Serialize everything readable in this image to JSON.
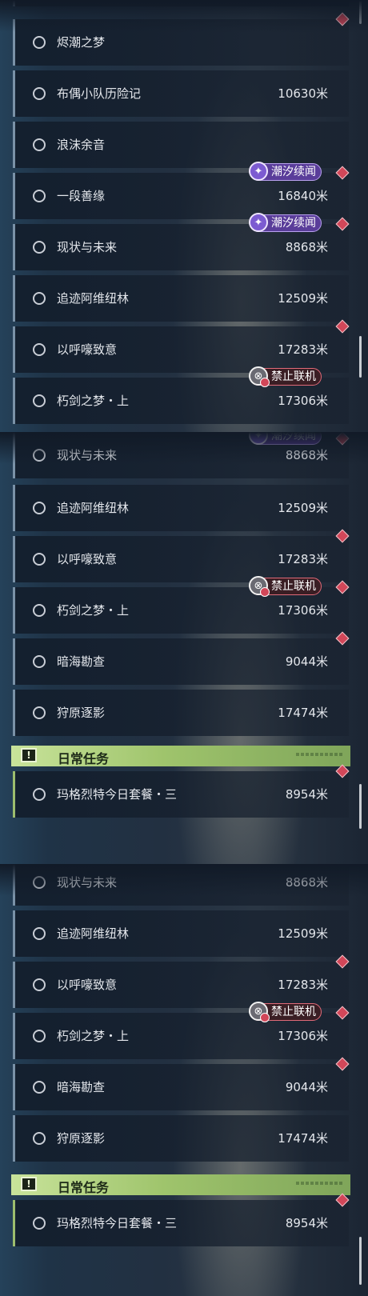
{
  "quests_panel1": [
    {
      "name": "烬潮之梦",
      "distance": ""
    },
    {
      "name": "布偶小队历险记",
      "distance": "10630米"
    },
    {
      "name": "浪沫余音",
      "distance": ""
    },
    {
      "name": "一段善缘",
      "distance": "16840米"
    },
    {
      "name": "现状与未来",
      "distance": "8868米"
    },
    {
      "name": "追迹阿维纽林",
      "distance": "12509米"
    },
    {
      "name": "以呼嚎致意",
      "distance": "17283米"
    },
    {
      "name": "朽剑之梦・上",
      "distance": "17306米"
    }
  ],
  "quests_panel2": [
    {
      "name": "现状与未来",
      "distance": "8868米"
    },
    {
      "name": "追迹阿维纽林",
      "distance": "12509米"
    },
    {
      "name": "以呼嚎致意",
      "distance": "17283米"
    },
    {
      "name": "朽剑之梦・上",
      "distance": "17306米"
    },
    {
      "name": "暗海勘查",
      "distance": "9044米"
    },
    {
      "name": "狩原逐影",
      "distance": "17474米"
    }
  ],
  "quests_panel3": [
    {
      "name": "现状与未来",
      "distance": "8868米"
    },
    {
      "name": "追迹阿维纽林",
      "distance": "12509米"
    },
    {
      "name": "以呼嚎致意",
      "distance": "17283米"
    },
    {
      "name": "朽剑之梦・上",
      "distance": "17306米"
    },
    {
      "name": "暗海勘查",
      "distance": "9044米"
    },
    {
      "name": "狩原逐影",
      "distance": "17474米"
    }
  ],
  "daily_section": {
    "title": "日常任务",
    "icon_label": "!"
  },
  "daily_quest": {
    "name": "玛格烈特今日套餐・三",
    "distance": "8954米"
  },
  "badges": {
    "story": "潮汐续闻",
    "no_coop": "禁止联机"
  },
  "icons": {
    "quest": "circle-icon",
    "marker": "red-diamond-icon",
    "story": "star-burst-icon",
    "no_coop": "no-coop-icon"
  },
  "colors": {
    "accent_daily": "#9fc46c",
    "marker": "#d24759",
    "story_badge": "#5a3d9a",
    "no_coop_badge": "#e06a78"
  }
}
